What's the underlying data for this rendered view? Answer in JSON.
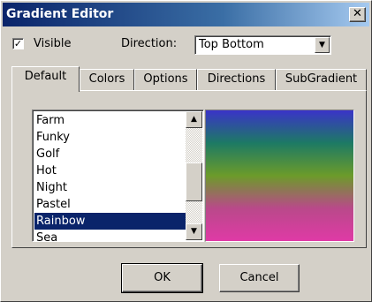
{
  "window": {
    "title": "Gradient Editor"
  },
  "options": {
    "visible_label": "Visible",
    "visible_checked": true,
    "direction_label": "Direction:",
    "direction_value": "Top Bottom"
  },
  "tabs": [
    {
      "label": "Default"
    },
    {
      "label": "Colors"
    },
    {
      "label": "Options"
    },
    {
      "label": "Directions"
    },
    {
      "label": "SubGradient"
    }
  ],
  "gradient_list": {
    "items": [
      "Farm",
      "Funky",
      "Golf",
      "Hot",
      "Night",
      "Pastel",
      "Rainbow",
      "Sea"
    ],
    "selected": "Rainbow"
  },
  "preview": {
    "colors": [
      "#3a33c8",
      "#1d7a64",
      "#6c9b2a",
      "#b9498a",
      "#e03aa6"
    ]
  },
  "buttons": {
    "ok": "OK",
    "cancel": "Cancel"
  },
  "icons": {
    "close": "close-icon",
    "dropdown": "chevron-down-icon",
    "scroll_up": "arrow-up-icon",
    "scroll_down": "arrow-down-icon",
    "check": "checkmark-icon"
  }
}
